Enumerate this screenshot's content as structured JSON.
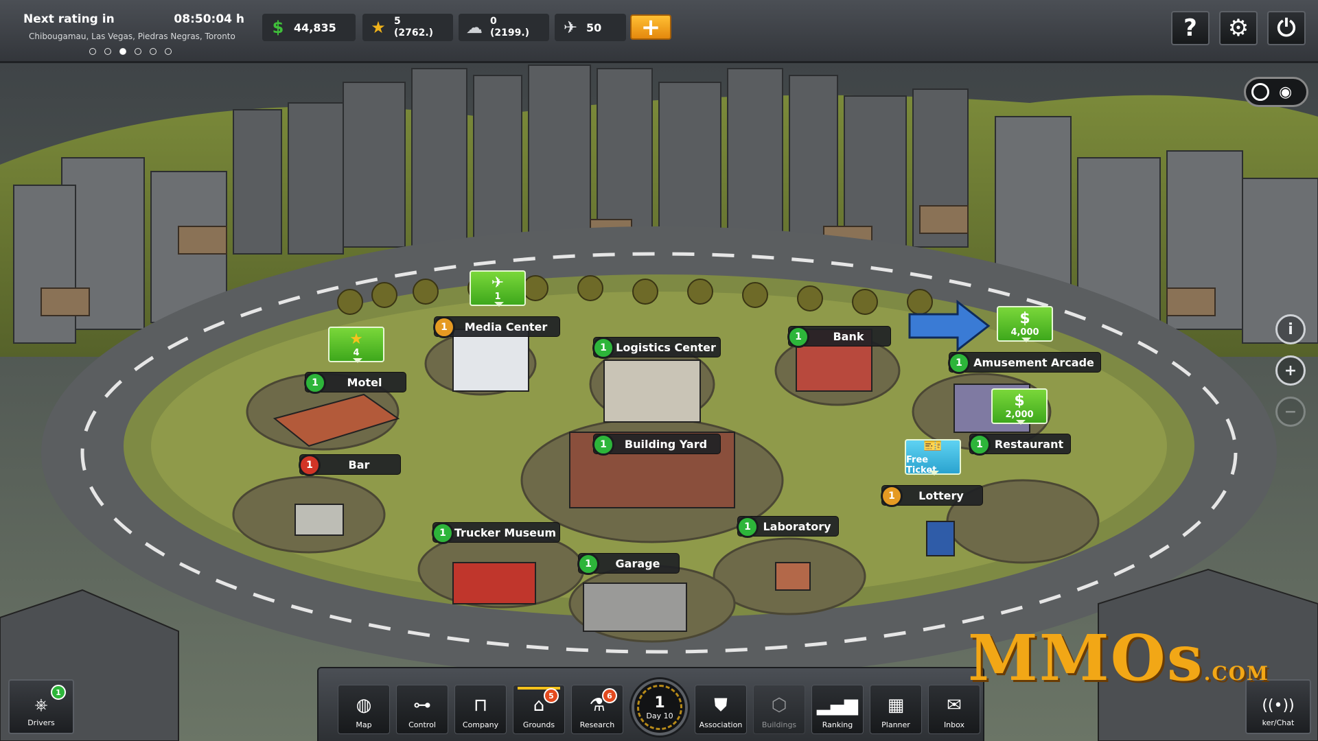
{
  "rating": {
    "label": "Next rating in",
    "time": "08:50:04 h",
    "cities": "Chibougamau, Las Vegas, Piedras Negras, Toronto",
    "page_dots": 6,
    "active_dot": 2
  },
  "stats": {
    "money": "44,835",
    "stars": "5",
    "stars_sub": "(2762.)",
    "fans": "0",
    "fans_sub": "(2199.)",
    "tickets": "50"
  },
  "system": {
    "help": "?",
    "settings_icon": "gear-icon",
    "power_icon": "power-icon"
  },
  "locations": [
    {
      "name": "Media Center",
      "level": "1",
      "status": "orange"
    },
    {
      "name": "Logistics Center",
      "level": "1",
      "status": "green"
    },
    {
      "name": "Bank",
      "level": "1",
      "status": "green"
    },
    {
      "name": "Amusement Arcade",
      "level": "1",
      "status": "green"
    },
    {
      "name": "Motel",
      "level": "1",
      "status": "green"
    },
    {
      "name": "Bar",
      "level": "1",
      "status": "red"
    },
    {
      "name": "Building Yard",
      "level": "1",
      "status": "green"
    },
    {
      "name": "Restaurant",
      "level": "1",
      "status": "green"
    },
    {
      "name": "Lottery",
      "level": "1",
      "status": "orange"
    },
    {
      "name": "Laboratory",
      "level": "1",
      "status": "green"
    },
    {
      "name": "Trucker Museum",
      "level": "1",
      "status": "green"
    },
    {
      "name": "Garage",
      "level": "1",
      "status": "green"
    }
  ],
  "bubbles": {
    "media": "1",
    "motel": "4",
    "arcade": "4,000",
    "restaurant": "2,000",
    "lottery": "Free Ticket"
  },
  "nav": [
    {
      "label": "Map",
      "icon": "globe-icon"
    },
    {
      "label": "Control",
      "icon": "control-icon"
    },
    {
      "label": "Company",
      "icon": "company-icon"
    },
    {
      "label": "Grounds",
      "icon": "grounds-icon",
      "count": "5"
    },
    {
      "label": "Research",
      "icon": "research-icon",
      "count": "6"
    },
    {
      "label": "Association",
      "icon": "shield-icon"
    },
    {
      "label": "Buildings",
      "icon": "buildings-icon",
      "disabled": true
    },
    {
      "label": "Ranking",
      "icon": "ranking-icon"
    },
    {
      "label": "Planner",
      "icon": "planner-icon"
    },
    {
      "label": "Inbox",
      "icon": "inbox-icon"
    }
  ],
  "day": {
    "number": "1",
    "label": "Day 10"
  },
  "drivers": {
    "label": "Drivers",
    "count": "1"
  },
  "chat": {
    "label": "ker/Chat"
  },
  "watermark": {
    "text": "MMOs",
    "suffix": ".COM"
  },
  "colors": {
    "accent": "#f5a623",
    "green_badge": "#2db53a",
    "red_badge": "#d23426",
    "orange_badge": "#e59a22"
  }
}
